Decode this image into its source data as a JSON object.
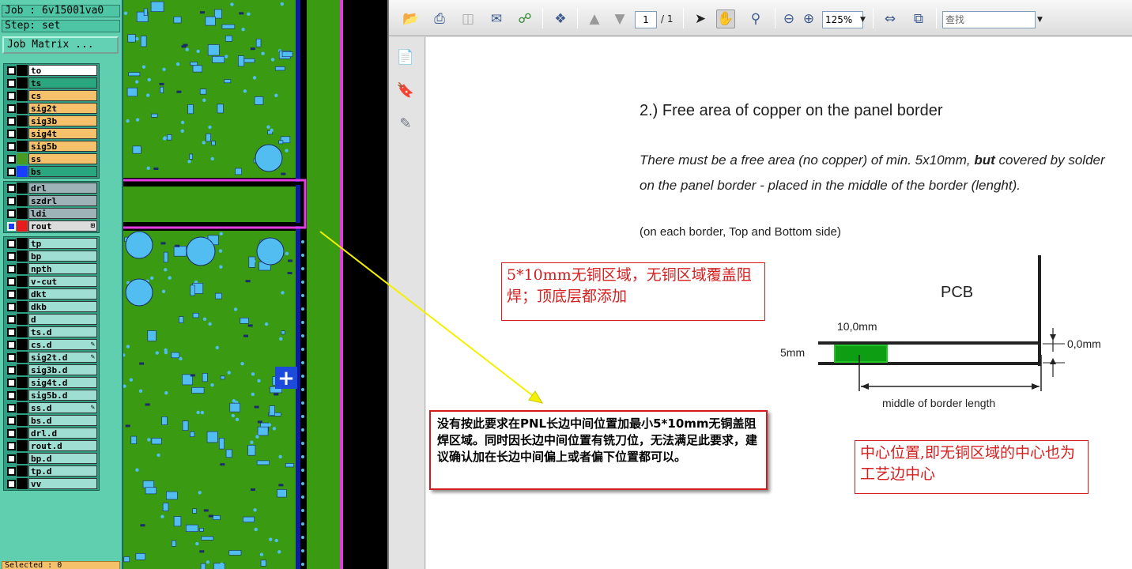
{
  "cam": {
    "job": "Job : 6v15001va0",
    "step": "Step: set",
    "job_matrix": "Job Matrix ...",
    "selected": "Selected : 0",
    "groups": [
      {
        "layers": [
          {
            "name": "to",
            "color": "#ffffff"
          },
          {
            "name": "ts",
            "color": "#2aa77e"
          },
          {
            "name": "cs",
            "color": "#f5c16a"
          },
          {
            "name": "sig2t",
            "color": "#f5c16a"
          },
          {
            "name": "sig3b",
            "color": "#f5c16a"
          },
          {
            "name": "sig4t",
            "color": "#f5c16a"
          },
          {
            "name": "sig5b",
            "color": "#f5c16a"
          },
          {
            "name": "ss",
            "color": "#f5c16a",
            "swatch": "#4a9a22"
          },
          {
            "name": "bs",
            "color": "#2aa77e",
            "swatch": "#1a3cff"
          }
        ]
      },
      {
        "layers": [
          {
            "name": "drl",
            "color": "#9db3b8"
          },
          {
            "name": "szdrl",
            "color": "#9db3b8"
          },
          {
            "name": "ldi",
            "color": "#9db3b8"
          },
          {
            "name": "rout",
            "color": "#dcdcdc",
            "swatch": "#e81c1c",
            "box": "#1a3cff"
          }
        ]
      },
      {
        "layers": [
          {
            "name": "tp",
            "color": "#9fded2"
          },
          {
            "name": "bp",
            "color": "#9fded2"
          },
          {
            "name": "npth",
            "color": "#9fded2"
          },
          {
            "name": "v-cut",
            "color": "#9fded2"
          },
          {
            "name": "dkt",
            "color": "#9fded2"
          },
          {
            "name": "dkb",
            "color": "#9fded2"
          },
          {
            "name": "d",
            "color": "#9fded2"
          },
          {
            "name": "ts.d",
            "color": "#9fded2"
          },
          {
            "name": "cs.d",
            "color": "#9fded2"
          },
          {
            "name": "sig2t.d",
            "color": "#9fded2"
          },
          {
            "name": "sig3b.d",
            "color": "#9fded2"
          },
          {
            "name": "sig4t.d",
            "color": "#9fded2"
          },
          {
            "name": "sig5b.d",
            "color": "#9fded2"
          },
          {
            "name": "ss.d",
            "color": "#9fded2"
          },
          {
            "name": "bs.d",
            "color": "#9fded2"
          },
          {
            "name": "drl.d",
            "color": "#9fded2"
          },
          {
            "name": "rout.d",
            "color": "#9fded2"
          },
          {
            "name": "bp.d",
            "color": "#9fded2"
          },
          {
            "name": "tp.d",
            "color": "#9fded2"
          },
          {
            "name": "vv",
            "color": "#9fded2"
          }
        ]
      }
    ]
  },
  "pcb": {
    "colors": {
      "board": "#3a9b12",
      "pad": "#52bdf0",
      "outline": "#e23ce2",
      "rout": "#0d1d9e"
    },
    "plus_sign": "+"
  },
  "viewer": {
    "toolbar": {
      "icons": [
        "open-icon",
        "print-icon",
        "save-icon",
        "email-icon",
        "web-icon",
        "attach-icon",
        "prev-page-icon",
        "next-page-icon",
        "select-tool-icon",
        "hand-tool-icon",
        "zoom-tool-icon",
        "zoom-out-icon",
        "zoom-in-icon",
        "fit-width-icon",
        "fit-page-icon"
      ],
      "page_value": "1",
      "page_total": "/ 1",
      "zoom_value": "125%",
      "search_placeholder": "查找"
    },
    "document": {
      "heading": "2.) Free area of copper on the panel border",
      "para_line1_a": "There must be a free area (no copper) of min. 5x10mm, ",
      "para_line1_bold": "but",
      "para_line1_b": " covered by solder",
      "para_line2": "on the panel border - placed in the middle of the border (lenght).",
      "para_note": "(on each border, Top and Bottom side)",
      "red_note1": "5*10mm无铜区域，无铜区域覆盖阻焊；顶底层都添加",
      "red_note2": "中心位置,即无铜区域的中心也为工艺边中心",
      "diagram": {
        "pcb_label": "PCB",
        "width_label": "10,0mm",
        "height_label": "5mm",
        "offset_label": "0,0mm",
        "middle_label": "middle of border length"
      }
    }
  },
  "annotation": {
    "text": "没有按此要求在PNL长边中间位置加最小5*10mm无铜盖阻焊区域。同时因长边中间位置有铣刀位，无法满足此要求，建议确认加在长边中间偏上或者偏下位置都可以。"
  }
}
